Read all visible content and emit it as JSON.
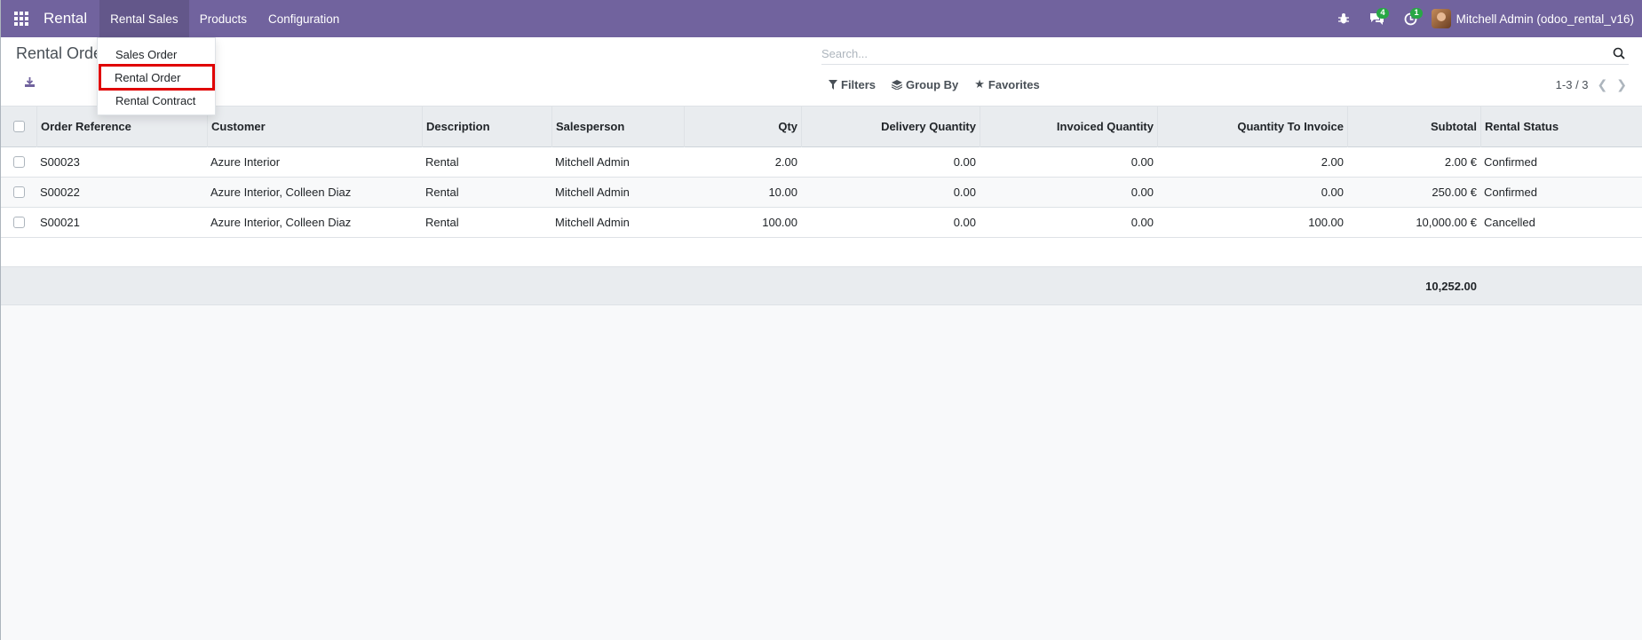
{
  "navbar": {
    "brand": "Rental",
    "menus": [
      "Rental Sales",
      "Products",
      "Configuration"
    ],
    "messages_count": "4",
    "activities_count": "1",
    "user": "Mitchell Admin (odoo_rental_v16)"
  },
  "dropdown": {
    "items": [
      "Sales Order",
      "Rental Order",
      "Rental Contract"
    ]
  },
  "control_panel": {
    "breadcrumb": "Rental Orders",
    "search_placeholder": "Search...",
    "filters_label": "Filters",
    "groupby_label": "Group By",
    "favorites_label": "Favorites",
    "pager": "1-3 / 3"
  },
  "table": {
    "headers": {
      "ref": "Order Reference",
      "customer": "Customer",
      "description": "Description",
      "salesperson": "Salesperson",
      "qty": "Qty",
      "delivery": "Delivery Quantity",
      "invoiced": "Invoiced Quantity",
      "to_invoice": "Quantity To Invoice",
      "subtotal": "Subtotal",
      "status": "Rental Status"
    },
    "rows": [
      {
        "ref": "S00023",
        "customer": "Azure Interior",
        "description": "Rental",
        "salesperson": "Mitchell Admin",
        "qty": "2.00",
        "delivery": "0.00",
        "invoiced": "0.00",
        "to_invoice": "2.00",
        "subtotal": "2.00 €",
        "status": "Confirmed"
      },
      {
        "ref": "S00022",
        "customer": "Azure Interior, Colleen Diaz",
        "description": "Rental",
        "salesperson": "Mitchell Admin",
        "qty": "10.00",
        "delivery": "0.00",
        "invoiced": "0.00",
        "to_invoice": "0.00",
        "subtotal": "250.00 €",
        "status": "Confirmed"
      },
      {
        "ref": "S00021",
        "customer": "Azure Interior, Colleen Diaz",
        "description": "Rental",
        "salesperson": "Mitchell Admin",
        "qty": "100.00",
        "delivery": "0.00",
        "invoiced": "0.00",
        "to_invoice": "100.00",
        "subtotal": "10,000.00 €",
        "status": "Cancelled"
      }
    ],
    "total": "10,252.00"
  },
  "colors": {
    "navbar": "#71639e",
    "highlight": "#e00000",
    "badge": "#28a745"
  }
}
